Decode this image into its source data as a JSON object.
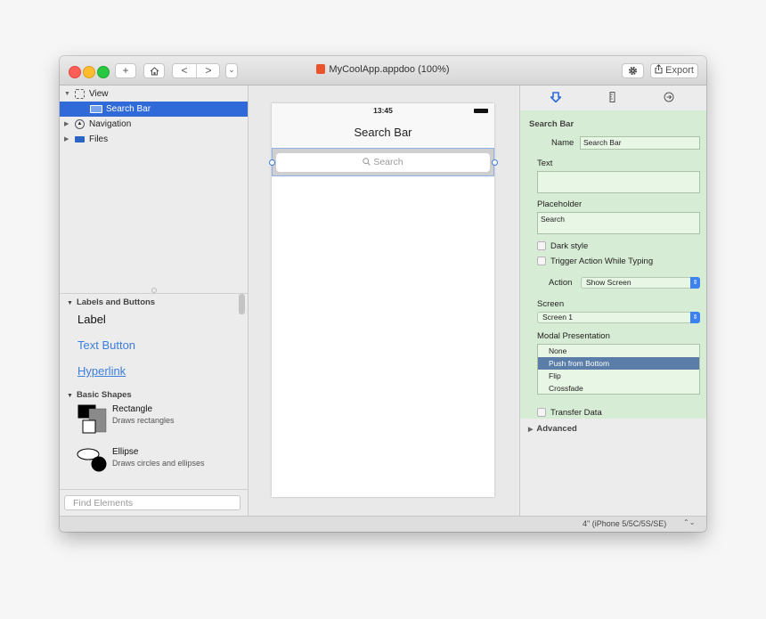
{
  "window": {
    "title": "MyCoolApp.appdoo (100%)",
    "toolbar": {
      "add_label": "+",
      "back_label": "<",
      "forward_label": ">",
      "dropdown_label": "⌄",
      "export_label": "Export"
    }
  },
  "tree": {
    "items": [
      {
        "label": "View"
      },
      {
        "label": "Search Bar"
      },
      {
        "label": "Navigation"
      },
      {
        "label": "Files"
      }
    ]
  },
  "library": {
    "section1": "Labels and Buttons",
    "label_item": "Label",
    "text_button_item": "Text Button",
    "hyperlink_item": "Hyperlink",
    "section2": "Basic Shapes",
    "rect_title": "Rectangle",
    "rect_desc": "Draws rectangles",
    "ellipse_title": "Ellipse",
    "ellipse_desc": "Draws circles and ellipses",
    "find_placeholder": "Find Elements"
  },
  "phone": {
    "time": "13:45",
    "nav_title": "Search Bar",
    "search_placeholder": "Search"
  },
  "inspector": {
    "section_title": "Search Bar",
    "name_label": "Name",
    "name_value": "Search Bar",
    "text_label": "Text",
    "text_value": "",
    "placeholder_label": "Placeholder",
    "placeholder_value": "Search",
    "dark_style": "Dark style",
    "trigger_action": "Trigger Action While Typing",
    "action_label": "Action",
    "action_value": "Show Screen",
    "screen_label": "Screen",
    "screen_value": "Screen 1",
    "modal_label": "Modal Presentation",
    "modal_options": [
      "None",
      "Push from Bottom",
      "Flip",
      "Crossfade"
    ],
    "modal_selected": "Push from Bottom",
    "transfer_data": "Transfer Data",
    "advanced": "Advanced"
  },
  "statusbar": {
    "device": "4\" (iPhone 5/5C/5S/SE)",
    "device_stepper": "⌃⌄"
  },
  "colors": {
    "accent": "#2f6ad8",
    "inspector_bg": "#d7ecd4",
    "link_blue": "#3b7ddd",
    "close": "#ff5f57",
    "minimize": "#febc2e",
    "zoom": "#28c840"
  }
}
